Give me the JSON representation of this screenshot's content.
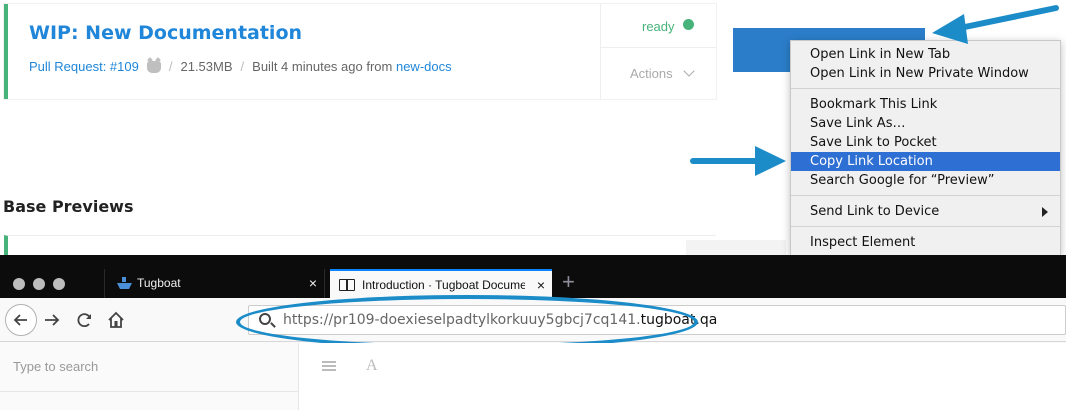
{
  "preview": {
    "title": "WIP: New Documentation",
    "pr_link": "Pull Request: #109",
    "size": "21.53MB",
    "sep1": "/",
    "sep2": "/",
    "built_text": "Built 4 minutes ago from",
    "branch": "new-docs",
    "status": "ready",
    "actions_label": "Actions"
  },
  "section_title": "Base Previews",
  "context_menu": {
    "items": [
      "Open Link in New Tab",
      "Open Link in New Private Window",
      "Bookmark This Link",
      "Save Link As…",
      "Save Link to Pocket",
      "Copy Link Location",
      "Search Google for “Preview”",
      "Send Link to Device",
      "Inspect Element"
    ],
    "highlighted": "Copy Link Location"
  },
  "browser": {
    "tabs": [
      {
        "label": "Tugboat",
        "icon": "boat-icon"
      },
      {
        "label": "Introduction · Tugboat Documentation",
        "icon": "book-icon"
      }
    ],
    "close_glyph": "×",
    "new_tab_glyph": "+",
    "url_path": "https://pr109-doexieselpadtylkorkuuy5gbcj7cq141.",
    "url_host": "tugboat.qa",
    "search_placeholder": "Type to search",
    "font_glyph": "A"
  },
  "colors": {
    "accent_green": "#47b37a",
    "link_blue": "#1f86d9",
    "highlight": "#2e6fd4",
    "annotation_blue": "#1b8cc8"
  }
}
